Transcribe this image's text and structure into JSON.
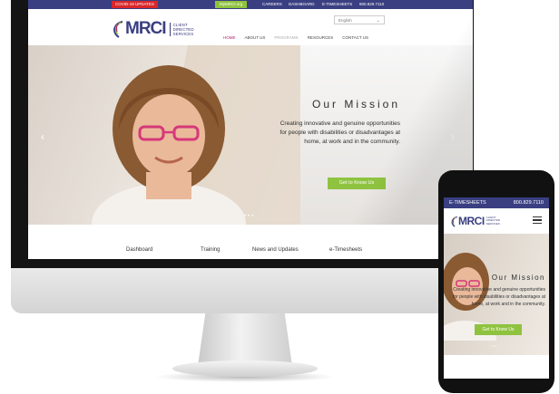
{
  "desktop": {
    "topbar": {
      "covid_label": "COVID-19 UPDATES",
      "mymrci_label": "MyMRCI.org",
      "careers_label": "CAREERS",
      "dashboard_label": "DASHBOARD",
      "etimesheets_label": "E-TIMESHEETS",
      "phone": "800.829.7110"
    },
    "header": {
      "logo_text": "MRCI",
      "logo_sub_1": "CLIENT",
      "logo_sub_2": "DIRECTED",
      "logo_sub_3": "SERVICES",
      "language_selected": "English",
      "nav": [
        {
          "label": "HOME"
        },
        {
          "label": "ABOUT US"
        },
        {
          "label": "PROGRAMS"
        },
        {
          "label": "RESOURCES"
        },
        {
          "label": "CONTACT US"
        }
      ]
    },
    "hero": {
      "title": "Our Mission",
      "text": "Creating innovative and genuine opportunities for people with disabilities or disadvantages at home, at work and in the community.",
      "button_label": "Get to Know Us"
    },
    "quick_links": [
      {
        "label": "Dashboard"
      },
      {
        "label": "Training"
      },
      {
        "label": "News and Updates"
      },
      {
        "label": "e-Timesheets"
      }
    ]
  },
  "mobile": {
    "topbar": {
      "etimesheets_label": "E-TIMESHEETS",
      "phone": "800.829.7110"
    },
    "logo_text": "MRCI",
    "logo_sub_1": "CLIENT",
    "logo_sub_2": "DIRECTED",
    "logo_sub_3": "SERVICES",
    "hero": {
      "title": "Our Mission",
      "text": "Creating innovative and genuine opportunities for people with disabilities or disadvantages at home, at work and in the community.",
      "button_label": "Get to Know Us"
    }
  },
  "colors": {
    "brand_navy": "#3a3f82",
    "accent_green": "#8fc33f",
    "alert_red": "#d8262a",
    "accent_magenta": "#b3206f"
  },
  "icons": {
    "hero_prev": "chevron-left-icon",
    "hero_next": "chevron-right-icon",
    "menu": "hamburger-menu-icon",
    "dropdown": "chevron-down-icon"
  }
}
